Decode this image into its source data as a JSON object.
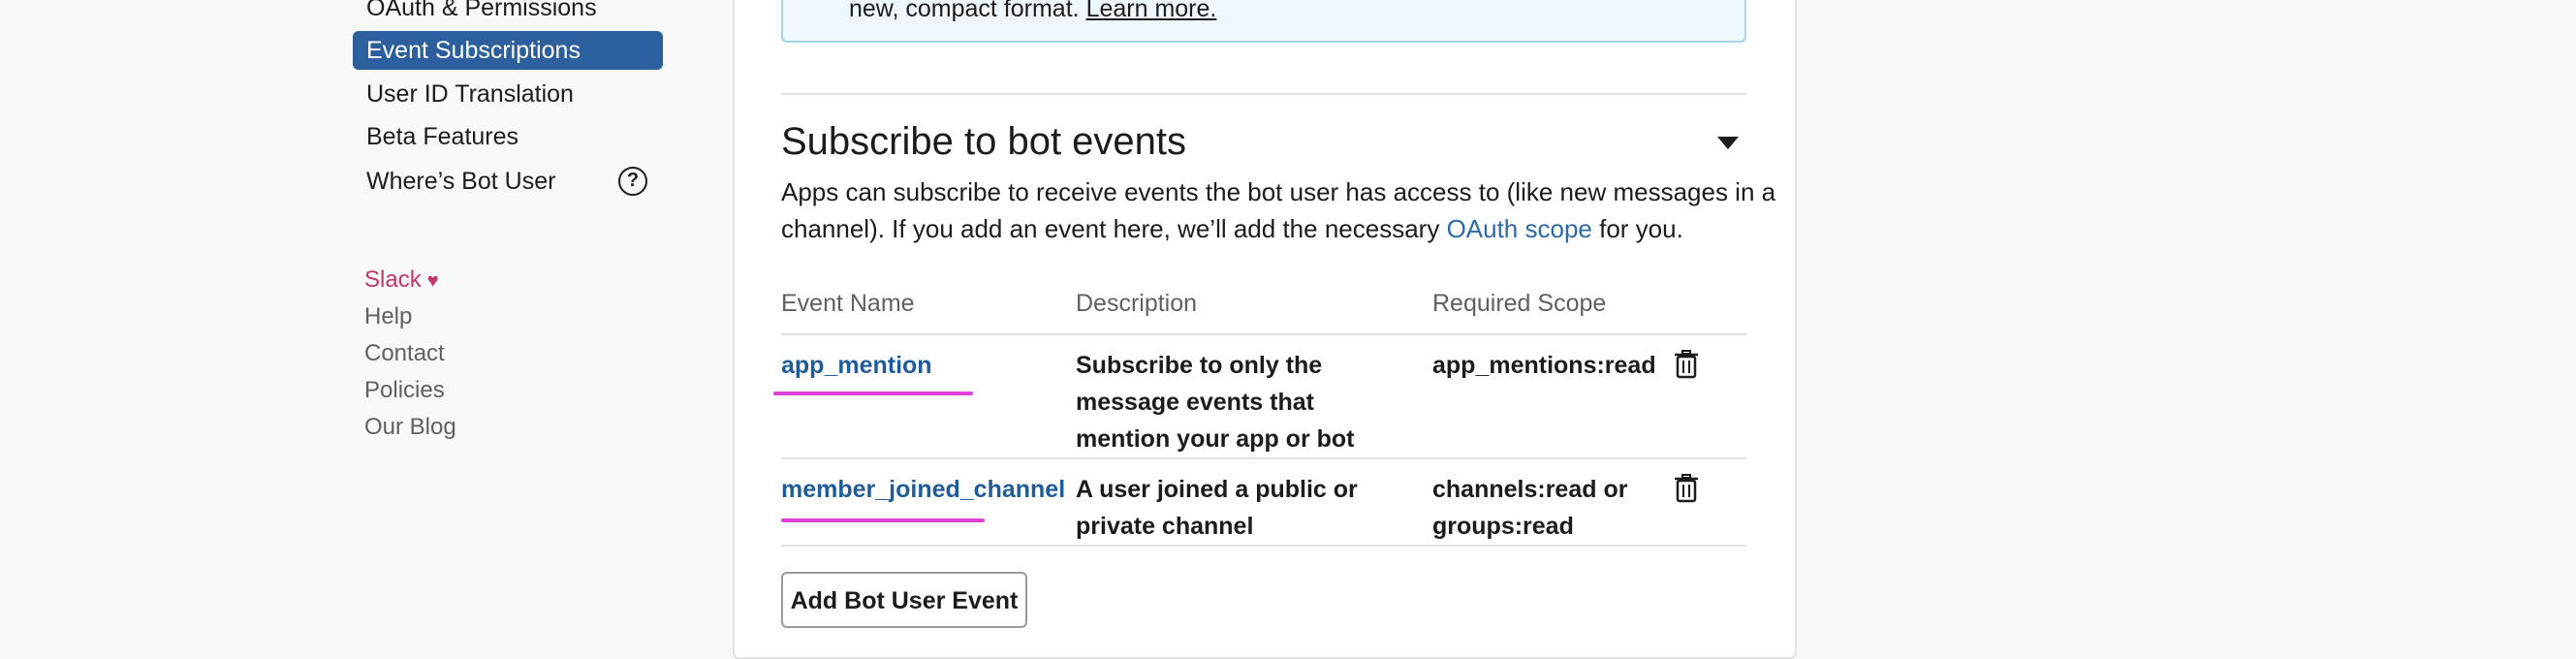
{
  "sidebar": {
    "items": [
      {
        "label": "OAuth & Permissions"
      },
      {
        "label": "Event Subscriptions"
      },
      {
        "label": "User ID Translation"
      },
      {
        "label": "Beta Features"
      },
      {
        "label": "Where’s Bot User"
      }
    ],
    "help_glyph": "?",
    "footer": {
      "brand": "Slack",
      "links": [
        "Help",
        "Contact",
        "Policies",
        "Our Blog"
      ]
    }
  },
  "info_banner": {
    "text": "new, compact format.",
    "link": "Learn more."
  },
  "section": {
    "title": "Subscribe to bot events",
    "desc_line1": "Apps can subscribe to receive events the bot user has access to (like new messages in a",
    "desc_line2_prefix": "channel). If you add an event here, we’ll add the necessary",
    "desc_link": "OAuth scope",
    "desc_line2_suffix": "for you."
  },
  "table": {
    "headers": [
      "Event Name",
      "Description",
      "Required Scope"
    ],
    "rows": [
      {
        "event": "app_mention",
        "description_lines": [
          "Subscribe to only the",
          "message events that",
          "mention your app or bot"
        ],
        "scope_lines": [
          "app_mentions:read"
        ]
      },
      {
        "event": "member_joined_channel",
        "description_lines": [
          "A user joined a public or",
          "private channel"
        ],
        "scope_lines": [
          "channels:read or",
          "groups:read"
        ]
      }
    ]
  },
  "add_button": {
    "label": "Add Bot User Event"
  },
  "colors": {
    "accent": "#2c5f9e",
    "link": "#1f5c99",
    "brand": "#c4356d",
    "annotation": "#e040d8"
  }
}
